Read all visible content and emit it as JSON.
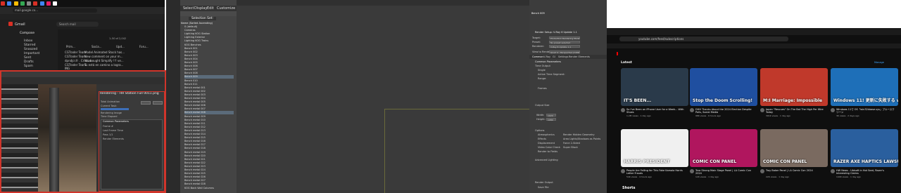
{
  "gmail": {
    "url": "mail.google.co...",
    "app_name": "Gmail",
    "search_placeholder": "Search mail",
    "mailbox": "Mailbo...",
    "compose": "Compose",
    "folders": [
      "Inbox",
      "Starred",
      "Snoozed",
      "Important",
      "Sent",
      "Drafts",
      "Spam"
    ],
    "columns": [
      "Prim...",
      "Socia...",
      "Upd...",
      "Foru..."
    ],
    "range": "1–50 of 2,042",
    "rows": [
      {
        "sender": "CGTrader Team",
        "subject": "Model Animated Stock has..."
      },
      {
        "sender": "CGTrader Team",
        "subject": "New comment on your m..."
      },
      {
        "sender": "dpndjcr.fr . Cristian",
        "subject": "You bought Simplify !!! ve..."
      },
      {
        "sender": "CGTrader Team",
        "subject": "Tu está en camino a logra..."
      },
      {
        "sender": "ING",
        "subject": ""
      }
    ]
  },
  "renderer": {
    "dialog_title": "Rendering - HH Station Full 0011.png",
    "panel_title": "Common Parameters",
    "lines": [
      "Total Animation",
      "Current Task:",
      "Rendering Image",
      "Time Elapsed",
      "Frame #",
      "Last Frame Time",
      "Pass 1/1",
      "Render Elements"
    ]
  },
  "explorer": {
    "menu": [
      "Select",
      "Display",
      "Edit",
      "Customize"
    ],
    "selection_set": "Selection Set:",
    "header": "Name (Sorted Ascending)",
    "rows": [
      {
        "name": "0 (default)",
        "selected": false
      },
      {
        "name": "Cameras",
        "selected": false
      },
      {
        "name": "Lighting KOG Station",
        "selected": false
      },
      {
        "name": "Lighting Exterior",
        "selected": false
      },
      {
        "name": "Lighting KOG Trains",
        "selected": false
      },
      {
        "name": "KOG Benches",
        "selected": false
      },
      {
        "name": "Bench 001",
        "selected": false
      },
      {
        "name": "Bench 002",
        "selected": false
      },
      {
        "name": "Bench 003",
        "selected": false
      },
      {
        "name": "Bench 004",
        "selected": false
      },
      {
        "name": "Bench 005",
        "selected": false
      },
      {
        "name": "Bench 006",
        "selected": false
      },
      {
        "name": "Bench 007",
        "selected": false
      },
      {
        "name": "Bench 008",
        "selected": false
      },
      {
        "name": "Bench 009",
        "selected": true
      },
      {
        "name": "Bench 010",
        "selected": false
      },
      {
        "name": "Bench 011",
        "selected": false
      },
      {
        "name": "Bench metal 001",
        "selected": false
      },
      {
        "name": "Bench metal 002",
        "selected": false
      },
      {
        "name": "Bench metal 003",
        "selected": false
      },
      {
        "name": "Bench metal 004",
        "selected": false
      },
      {
        "name": "Bench metal 005",
        "selected": false
      },
      {
        "name": "Bench metal 006",
        "selected": false
      },
      {
        "name": "Bench metal 007",
        "selected": false
      },
      {
        "name": "Bench metal 008",
        "selected": true
      },
      {
        "name": "Bench metal 009",
        "selected": false
      },
      {
        "name": "Bench metal 010",
        "selected": false
      },
      {
        "name": "Bench metal 011",
        "selected": false
      },
      {
        "name": "Bench metal 012",
        "selected": false
      },
      {
        "name": "Bench metal 013",
        "selected": false
      },
      {
        "name": "Bench metal 014",
        "selected": false
      },
      {
        "name": "Bench metal 015",
        "selected": false
      },
      {
        "name": "Bench metal 016",
        "selected": false
      },
      {
        "name": "Bench metal 017",
        "selected": false
      },
      {
        "name": "Bench metal 018",
        "selected": false
      },
      {
        "name": "Bench metal 019",
        "selected": false
      },
      {
        "name": "Bench metal 020",
        "selected": false
      },
      {
        "name": "Bench metal 021",
        "selected": false
      },
      {
        "name": "Bench metal 022",
        "selected": false
      },
      {
        "name": "Bench metal 023",
        "selected": false
      },
      {
        "name": "Bench metal 024",
        "selected": false
      },
      {
        "name": "Bench metal 025",
        "selected": false
      },
      {
        "name": "Bench metal 026",
        "selected": false
      },
      {
        "name": "Bench metal 027",
        "selected": false
      },
      {
        "name": "Bench metal 028",
        "selected": false
      },
      {
        "name": "KOG Back Wall Columns",
        "selected": false
      }
    ]
  },
  "render_setup": {
    "object": "Bench 009",
    "title": "Render Setup: V-Ray 6 Update 1.1",
    "target": "Production Rendering Mode",
    "preset": "No preset selected",
    "renderer": "V-Ray 6 Update 1.1",
    "view": "Quad 4 - Perspective (CAM)",
    "tabs": [
      "Common",
      "V-Ray",
      "GI",
      "Settings",
      "Render Elements"
    ],
    "section": "Common Parameters",
    "time_output": "Time Output",
    "options": [
      "Single",
      "Active Time Segment:",
      "Range:",
      "Frames"
    ],
    "output_size": "Output Size",
    "width": "1920",
    "height": "1080",
    "options_label": "Options",
    "checks": [
      "Atmospherics",
      "Effects",
      "Displacement",
      "Video Color Check",
      "Render to Fields",
      "Render Hidden Geometry",
      "Area Lights/Shadows as Points",
      "Force 2-Sided",
      "Super Black"
    ],
    "advanced": "Advanced Lighting",
    "render_output": "Render Output",
    "save_file": "Save File"
  },
  "youtube": {
    "url": "youtube.com/feed/subscriptions",
    "section": "Latest",
    "manage": "Manage",
    "shorts": "Shorts",
    "videos": [
      {
        "thumb_text": "IT'S BEEN...",
        "title": "So I've Been an iPhone User for a Week... With Shoes",
        "meta": "1.2M views · 1 day ago",
        "bg": "#2a3a4a"
      },
      {
        "thumb_text": "Stop the Doom Scrolling!",
        "title": "DHH Thanks About the 2024 Election Despite Polls, Social Media",
        "meta": "98K views · 6 hours ago",
        "bg": "#1f4fa0"
      },
      {
        "thumb_text": "M:I Marriage: Impossible",
        "title": "Japan \"Rescues\" On The Bat The High Per Wire Today",
        "meta": "301K views · 1 day ago",
        "bg": "#c0392b"
      },
      {
        "thumb_text": "Windows 11! 更新に失敗する win32kbase.sys",
        "title": "Windows 11で OS「win32kbase.sys」ブルースクリーン",
        "meta": "3K views · 2 days ago",
        "bg": "#1e6fb8"
      },
      {
        "thumb_text": "HARRIS PRESIDENT",
        "title": "People Are Falling for This Fake Kamala Harris Letter Frauds",
        "meta": "54K views · 4 hours ago",
        "bg": "#f0f0f0"
      },
      {
        "thumb_text": "COMIC CON PANEL",
        "title": "Tara Strong Main Stage Panel | LA Comic Con 2024",
        "meta": "12K views · 1 day ago",
        "bg": "#b0165e"
      },
      {
        "thumb_text": "COMIC CON PANEL",
        "title": "Troy Baker Panel | LA Comic Con 2024",
        "meta": "22K views · 1 day ago",
        "bg": "#7a6a60"
      },
      {
        "thumb_text": "RAZER AXE HAPTICS LAWSUIT",
        "title": "HW News - Ubisoft in Hot Seat, Razer's Interesting Claims",
        "meta": "140K views · 1 day ago",
        "bg": "#2a5f9e"
      }
    ]
  }
}
